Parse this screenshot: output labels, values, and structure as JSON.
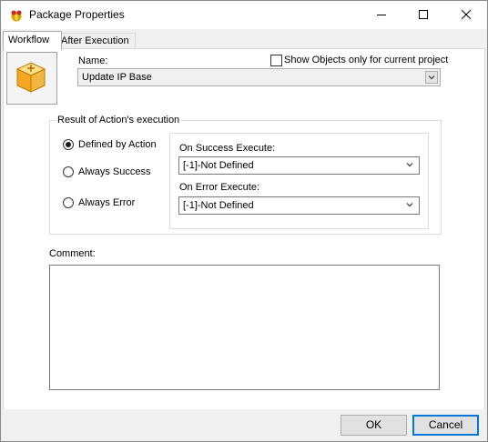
{
  "window": {
    "title": "Package Properties",
    "minimize_glyph": "—",
    "maximize_glyph": "☐",
    "close_glyph": "✕"
  },
  "tabs": [
    {
      "label": "Workflow",
      "active": true
    },
    {
      "label": "After Execution",
      "active": false
    }
  ],
  "form": {
    "name_label": "Name:",
    "name_value": "Update IP Base",
    "show_objects_label": "Show Objects only for current project",
    "show_objects_checked": false
  },
  "result_group": {
    "title": "Result of Action's execution",
    "options": [
      {
        "label": "Defined by  Action",
        "checked": true
      },
      {
        "label": "Always Success",
        "checked": false
      },
      {
        "label": "Always Error",
        "checked": false
      }
    ],
    "on_success_label": "On Success Execute:",
    "on_success_value": "[-1]-Not Defined",
    "on_error_label": "On Error Execute:",
    "on_error_value": "[-1]-Not Defined"
  },
  "comment": {
    "label": "Comment:",
    "value": ""
  },
  "buttons": {
    "ok_label": "OK",
    "cancel_label": "Cancel"
  },
  "colors": {
    "accent": "#0078d7",
    "icon_orange": "#f5a623"
  }
}
